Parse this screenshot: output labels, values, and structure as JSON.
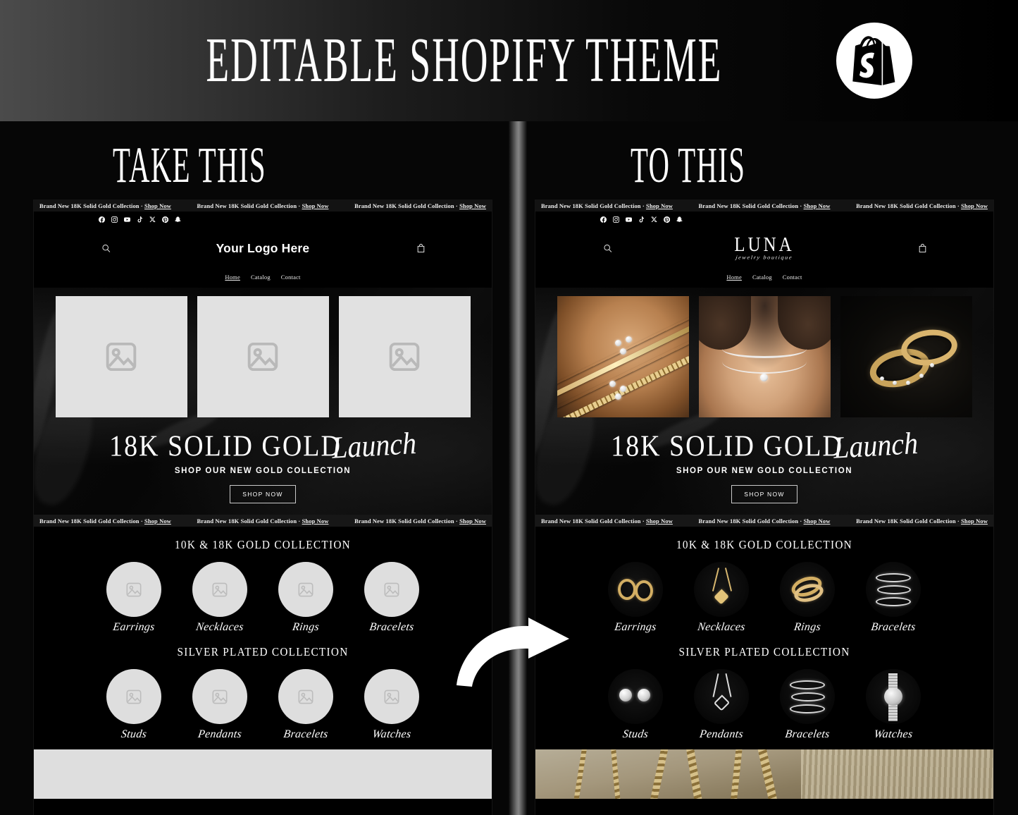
{
  "top_banner": {
    "title": "EDITABLE SHOPIFY THEME",
    "badge_icon": "shopify-bag-icon"
  },
  "stage": {
    "before_label": "TAKE THIS",
    "after_label": "TO THIS",
    "arrow_icon": "curved-arrow-right-icon"
  },
  "announcement": {
    "text": "Brand New 18K Solid Gold Collection ·",
    "link": "Shop Now",
    "repeat": 3
  },
  "social_icons": [
    "facebook-icon",
    "instagram-icon",
    "youtube-icon",
    "tiktok-icon",
    "x-twitter-icon",
    "pinterest-icon",
    "snapchat-icon"
  ],
  "header": {
    "search_icon": "search-icon",
    "cart_icon": "shopping-bag-icon",
    "logo_placeholder": "Your Logo Here",
    "logo_brand": "LUNA",
    "logo_tagline": "jewelry boutique",
    "nav": [
      "Home",
      "Catalog",
      "Contact"
    ],
    "nav_active": "Home"
  },
  "hero": {
    "title_main": "18K SOLID GOLD",
    "title_script": "Launch",
    "subtitle": "SHOP OUR NEW GOLD COLLECTION",
    "button": "SHOP NOW",
    "placeholder_icon": "image-placeholder-icon",
    "photos": [
      "gold-bracelets-on-arm",
      "silver-necklace-on-model",
      "gold-diamond-rings"
    ]
  },
  "collections": {
    "gold": {
      "title": "10K & 18K GOLD COLLECTION",
      "items": [
        {
          "name": "Earrings",
          "photo": "gold-hoop-earrings"
        },
        {
          "name": "Necklaces",
          "photo": "gold-heart-pendant-necklace"
        },
        {
          "name": "Rings",
          "photo": "gold-diamond-rings"
        },
        {
          "name": "Bracelets",
          "photo": "silver-diamond-bracelets"
        }
      ]
    },
    "silver": {
      "title": "SILVER PLATED COLLECTION",
      "items": [
        {
          "name": "Studs",
          "photo": "silver-diamond-studs"
        },
        {
          "name": "Pendants",
          "photo": "silver-heart-pendant"
        },
        {
          "name": "Bracelets",
          "photo": "silver-bangle-bracelets"
        },
        {
          "name": "Watches",
          "photo": "silver-diamond-watch"
        }
      ]
    }
  },
  "footer_strip": {
    "left_panel": "empty-gray-section",
    "right_panel": "gold-chains-photo"
  },
  "colors": {
    "background": "#000000",
    "banner_gradient_start": "#4b4b4b",
    "banner_gradient_end": "#000000",
    "placeholder_gray": "#e1e1e1",
    "accent_white": "#ffffff"
  }
}
